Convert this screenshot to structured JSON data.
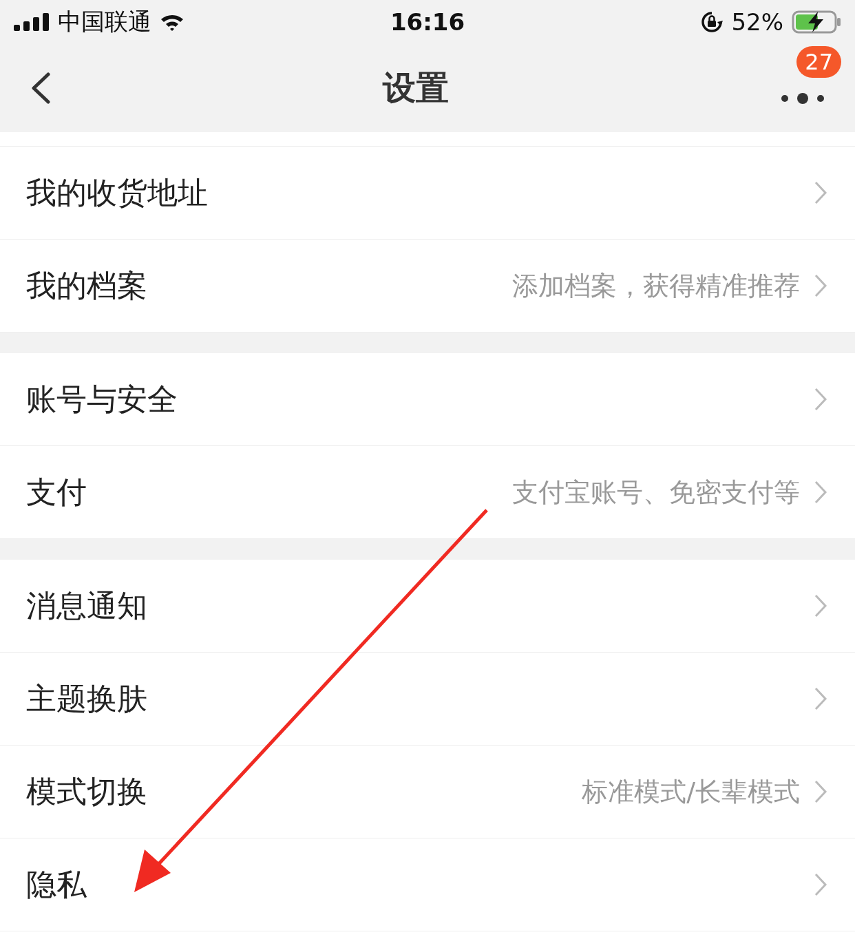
{
  "status_bar": {
    "carrier": "中国联通",
    "time": "16:16",
    "battery": "52%"
  },
  "nav": {
    "title": "设置",
    "badge": "27"
  },
  "sections": [
    {
      "rows": [
        {
          "label": "我的收货地址"
        },
        {
          "label": "我的档案",
          "hint": "添加档案，获得精准推荐"
        }
      ]
    },
    {
      "rows": [
        {
          "label": "账号与安全"
        },
        {
          "label": "支付",
          "hint": "支付宝账号、免密支付等"
        }
      ]
    },
    {
      "rows": [
        {
          "label": "消息通知"
        },
        {
          "label": "主题换肤"
        },
        {
          "label": "模式切换",
          "hint": "标准模式/长辈模式"
        },
        {
          "label": "隐私"
        }
      ]
    }
  ]
}
